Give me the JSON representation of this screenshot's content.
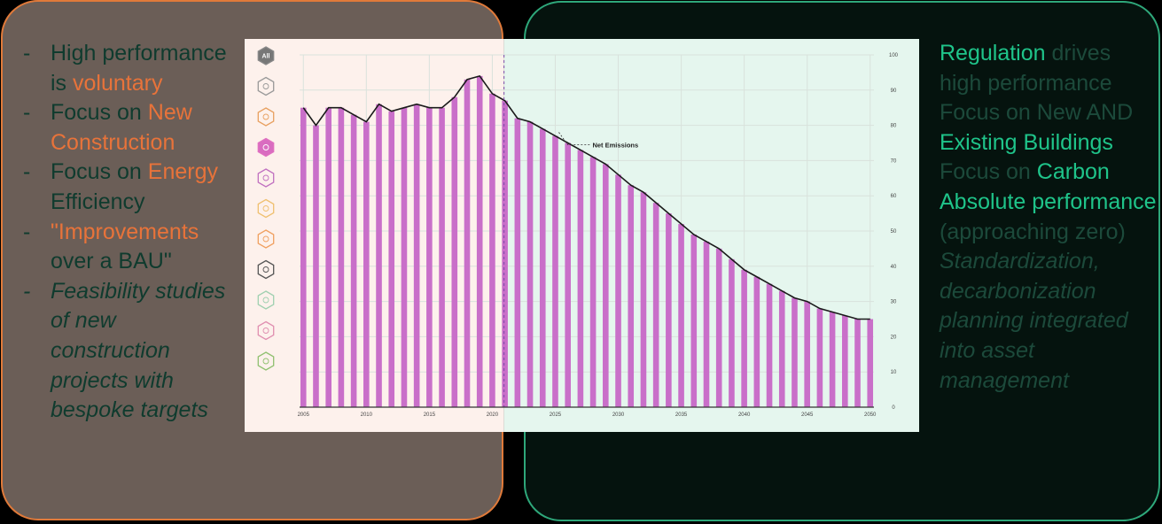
{
  "left_panel": {
    "items": [
      {
        "parts": [
          {
            "text": "High performance is ",
            "color": "green"
          },
          {
            "text": "voluntary",
            "color": "orange"
          }
        ]
      },
      {
        "parts": [
          {
            "text": "Focus on ",
            "color": "green"
          },
          {
            "text": "New Construction",
            "color": "orange"
          }
        ]
      },
      {
        "parts": [
          {
            "text": "Focus on ",
            "color": "green"
          },
          {
            "text": "Energy",
            "color": "orange"
          },
          {
            "text": " Efficiency",
            "color": "green"
          }
        ]
      },
      {
        "parts": [
          {
            "text": "\"Improvements",
            "color": "orange"
          },
          {
            "text": " over a BAU\"",
            "color": "green"
          }
        ]
      },
      {
        "parts": [
          {
            "text": "Feasibility studies of new construction projects with bespoke targets",
            "color": "green"
          }
        ],
        "italic": true
      }
    ]
  },
  "right_panel": {
    "lines": [
      {
        "parts": [
          {
            "text": "Regulation",
            "hl": true
          },
          {
            "text": " drives high performance",
            "hl": false
          }
        ]
      },
      {
        "parts": [
          {
            "text": "Focus on New AND ",
            "hl": false
          },
          {
            "text": "Existing Buildings",
            "hl": true
          }
        ]
      },
      {
        "parts": [
          {
            "text": "Focus on ",
            "hl": false
          },
          {
            "text": "Carbon Absolute performance",
            "hl": true
          },
          {
            "text": " (approaching zero)",
            "hl": false
          }
        ]
      },
      {
        "parts": [
          {
            "text": "Standardization, decarbonization planning integrated into asset management",
            "hl": false
          }
        ],
        "italic": true
      }
    ]
  },
  "sidebar_icons": [
    "all-icon",
    "building-icon",
    "yen-icon",
    "home-icon",
    "factory-icon",
    "car-icon",
    "chart-icon",
    "tree-icon",
    "leaf-icon",
    "n-icon",
    "plant-icon"
  ],
  "sidebar_all_label": "All",
  "colors": {
    "orange": "#e8733a",
    "green_text": "#0f3b2e",
    "highlight_green": "#1fc48a",
    "bar": "#c96fc9",
    "line": "#1a1a1a",
    "left_bg": "#fdf1ec",
    "right_bg": "#e5f6ee"
  },
  "chart_data": {
    "type": "bar",
    "annotation": "Net Emissions",
    "x": [
      2005,
      2006,
      2007,
      2008,
      2009,
      2010,
      2011,
      2012,
      2013,
      2014,
      2015,
      2016,
      2017,
      2018,
      2019,
      2020,
      2021,
      2022,
      2023,
      2024,
      2025,
      2026,
      2027,
      2028,
      2029,
      2030,
      2031,
      2032,
      2033,
      2034,
      2035,
      2036,
      2037,
      2038,
      2039,
      2040,
      2041,
      2042,
      2043,
      2044,
      2045,
      2046,
      2047,
      2048,
      2049,
      2050
    ],
    "values": [
      85,
      80,
      85,
      85,
      83,
      81,
      86,
      84,
      85,
      86,
      85,
      85,
      88,
      93,
      94,
      89,
      87,
      82,
      81,
      79,
      77,
      75,
      73,
      71,
      69,
      66,
      63,
      61,
      58,
      55,
      52,
      49,
      47,
      45,
      42,
      39,
      37,
      35,
      33,
      31,
      30,
      28,
      27,
      26,
      25,
      25
    ],
    "x_ticks": [
      2005,
      2010,
      2015,
      2020,
      2025,
      2030,
      2035,
      2040,
      2045,
      2050
    ],
    "y_ticks": [
      0,
      10,
      20,
      30,
      40,
      50,
      60,
      70,
      80,
      90,
      100
    ],
    "ylim": [
      0,
      100
    ],
    "split_year": 2021,
    "grid": true
  }
}
